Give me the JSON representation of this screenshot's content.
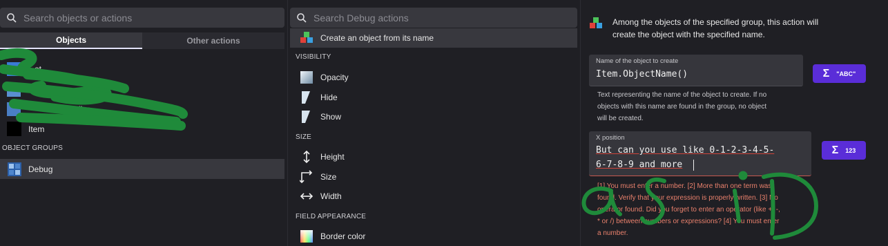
{
  "left_panel": {
    "search_placeholder": "Search objects or actions",
    "tabs": [
      {
        "label": "Objects"
      },
      {
        "label": "Other actions"
      }
    ],
    "objects": [
      {
        "label": "...ot"
      },
      {
        "label": "...ut"
      },
      {
        "label": "...dbu..."
      },
      {
        "label": "Item"
      }
    ],
    "groups_header": "OBJECT GROUPS",
    "groups": [
      {
        "label": "Debug"
      }
    ]
  },
  "middle_panel": {
    "search_placeholder": "Search Debug actions",
    "selected_action": "Create an object from its name",
    "sections": [
      {
        "header": "VISIBILITY",
        "items": [
          "Opacity",
          "Hide",
          "Show"
        ]
      },
      {
        "header": "SIZE",
        "items": [
          "Height",
          "Size",
          "Width"
        ]
      },
      {
        "header": "FIELD APPEARANCE",
        "items": [
          "Border color"
        ]
      }
    ]
  },
  "right_panel": {
    "description_line1": "Among the objects of the specified group, this action will",
    "description_line2": "create the object with the specified name.",
    "field1": {
      "label": "Name of the object to create",
      "value": "Item.ObjectName()",
      "button_label": "\"ABC\"",
      "help_line1": "Text representing the name of the object to create. If no",
      "help_line2": "objects with this name are found in the group, no object",
      "help_line3": "will be created."
    },
    "field2": {
      "label": "X position",
      "value_line1": "But can you use like 0-1-2-3-4-5-",
      "value_line2": "6-7-8-9 and more",
      "button_label": "123",
      "error_line1": "[1] You must enter a number. [2] More than one term was",
      "error_line2": "found. Verify that your expression is properly written. [3] No",
      "error_line3": "operator found. Did you forget to enter an operator (like +, -,",
      "error_line4": "* or /) between numbers or expressions? [4] You must enter",
      "error_line5": "a number."
    },
    "annotation": "asiD"
  },
  "colors": {
    "background": "#1f1f24",
    "accent_purple": "#5a2dd8",
    "error_red": "#e8806c",
    "scribble_green": "#1f8a3a"
  }
}
